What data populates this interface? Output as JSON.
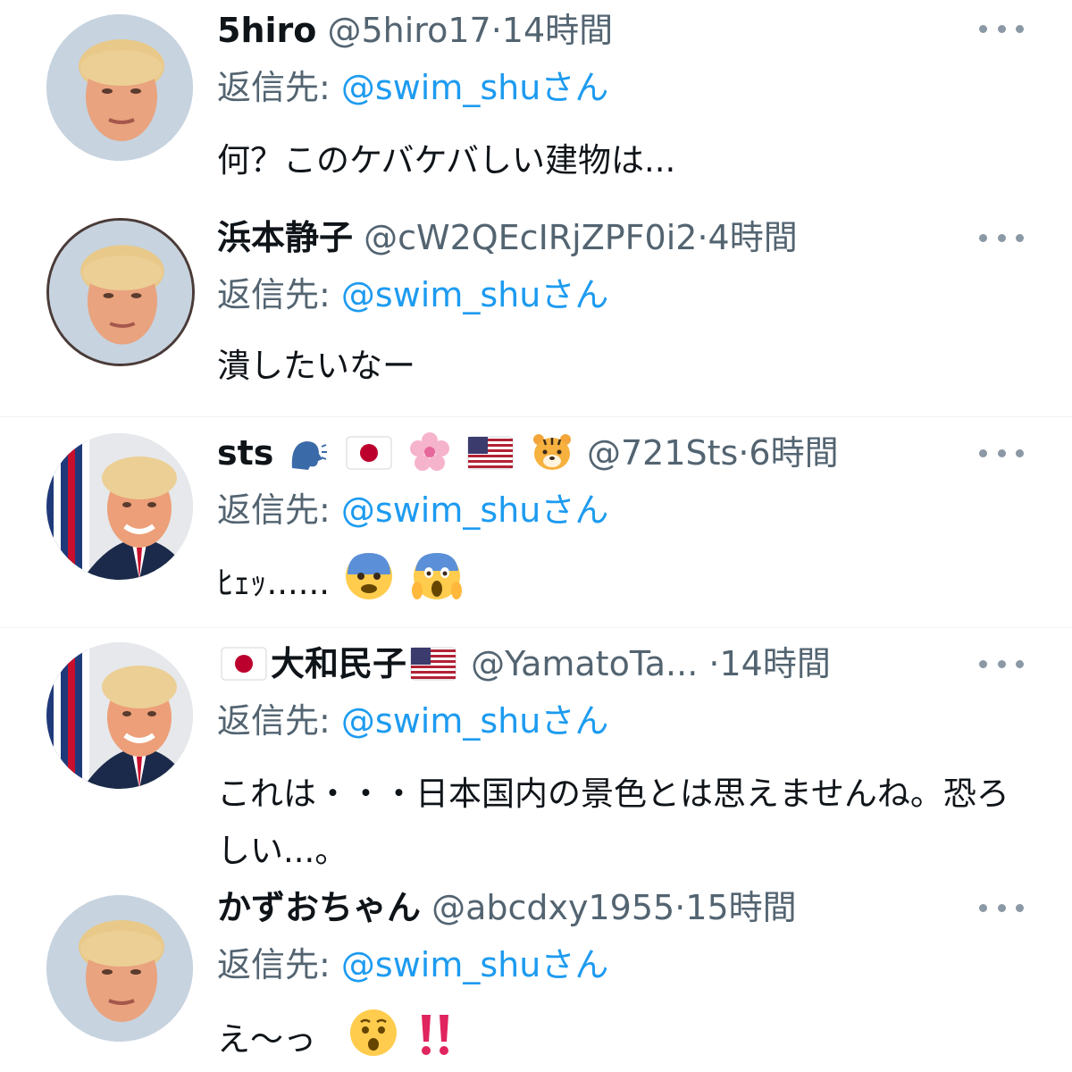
{
  "colors": {
    "text": "#0f1419",
    "secondary": "#536471",
    "link": "#1d9bf0",
    "more_dots": "#8b98a5"
  },
  "reply_prefix": "返信先:",
  "replies": [
    {
      "name": "5hiro",
      "handle": "@5hiro17",
      "separator": "·",
      "time": "14時間",
      "reply_to": "@swim_shuさん",
      "text": "何？このケバケバしい建物は..."
    },
    {
      "name": "浜本静子",
      "handle": "@cW2QEcIRjZPF0i2",
      "separator": "·",
      "time": "4時間",
      "reply_to": "@swim_shuさん",
      "text": "潰したいなー"
    },
    {
      "name": "sts",
      "name_icons": [
        "speaking-head-emoji",
        "japan-flag-emoji",
        "cherry-blossom-emoji",
        "us-flag-emoji",
        "tiger-face-emoji"
      ],
      "handle": "@721Sts",
      "separator": "·",
      "time": "6時間",
      "reply_to": "@swim_shuさん",
      "text": "ﾋｪｯ......",
      "text_icons": [
        "fearful-face-emoji",
        "screaming-face-emoji"
      ]
    },
    {
      "name": "大和民子",
      "name_icons": [
        "japan-flag-emoji",
        "us-flag-emoji"
      ],
      "handle": "@YamatoTa...",
      "separator": "·",
      "time": "14時間",
      "reply_to": "@swim_shuさん",
      "text": "これは・・・日本国内の景色とは思えませんね。恐ろしい...。"
    },
    {
      "name": "かずおちゃん",
      "handle": "@abcdxy1955",
      "separator": "·",
      "time": "15時間",
      "reply_to": "@swim_shuさん",
      "text": "え〜っ",
      "text_icons": [
        "hushed-face-emoji",
        "double-exclamation-emoji"
      ]
    }
  ]
}
